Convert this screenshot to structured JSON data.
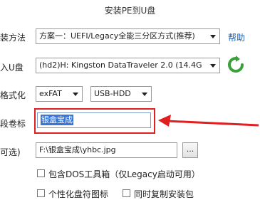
{
  "window": {
    "title": "安装PE到U盘"
  },
  "rows": {
    "method": {
      "label": "装方法",
      "value": "方案一：UEFI/Legacy全能三分区方式(推荐)",
      "help": "帮助"
    },
    "usb": {
      "label": "入U盘",
      "value": "(hd2)H: Kingston DataTraveler 2.0 (14.4G"
    },
    "format": {
      "label": "格式化",
      "fs": "exFAT",
      "mode": "USB-HDD"
    },
    "volume": {
      "label": "段卷标",
      "value": "银盒宝成"
    },
    "image": {
      "label": "可选)",
      "value": "F:\\银盒宝成\\yhbc.jpg",
      "browse": "..."
    }
  },
  "options": {
    "dos_tools": "包含DOS工具箱（仅Legacy启动可用）",
    "custom_icon": "个性化盘符图标",
    "copy_pkg": "同时复制安装包"
  },
  "colors": {
    "highlight": "#e02020",
    "link": "#1a5fb4",
    "selection": "#3875d7",
    "refresh": "#3aa03a"
  }
}
